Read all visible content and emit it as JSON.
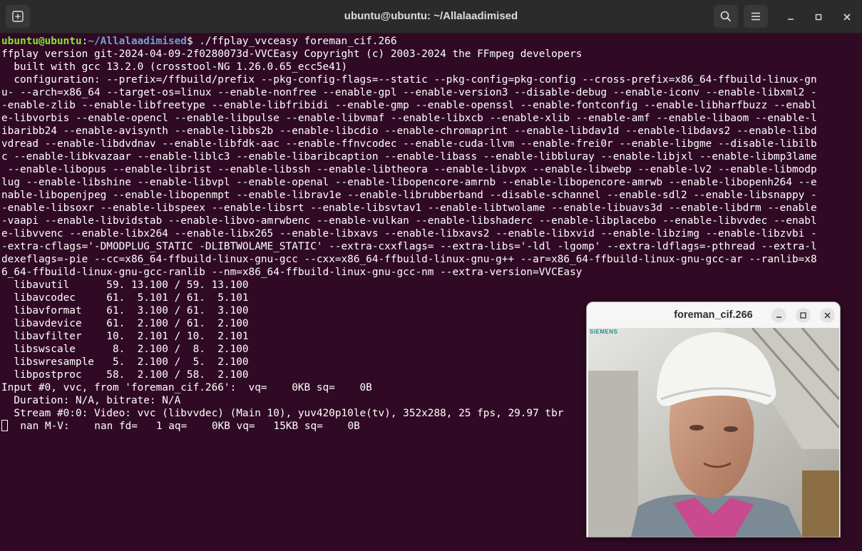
{
  "window": {
    "title": "ubuntu@ubuntu: ~/Allalaadimised",
    "icons": {
      "new_tab": "new-tab-icon",
      "search": "search-icon",
      "menu": "hamburger-menu-icon",
      "minimize": "minimize-icon",
      "maximize": "maximize-icon",
      "close": "close-icon"
    }
  },
  "terminal": {
    "prompt_user": "ubuntu@ubuntu",
    "prompt_sep": ":",
    "prompt_path": "~/Allalaadimised",
    "prompt_symbol": "$ ",
    "command": "./ffplay_vvceasy foreman_cif.266",
    "output_lines": [
      "ffplay version git-2024-04-09-2f0280073d-VVCEasy Copyright (c) 2003-2024 the FFmpeg developers",
      "  built with gcc 13.2.0 (crosstool-NG 1.26.0.65_ecc5e41)",
      "  configuration: --prefix=/ffbuild/prefix --pkg-config-flags=--static --pkg-config=pkg-config --cross-prefix=x86_64-ffbuild-linux-gn",
      "u- --arch=x86_64 --target-os=linux --enable-nonfree --enable-gpl --enable-version3 --disable-debug --enable-iconv --enable-libxml2 -",
      "-enable-zlib --enable-libfreetype --enable-libfribidi --enable-gmp --enable-openssl --enable-fontconfig --enable-libharfbuzz --enabl",
      "e-libvorbis --enable-opencl --enable-libpulse --enable-libvmaf --enable-libxcb --enable-xlib --enable-amf --enable-libaom --enable-l",
      "ibaribb24 --enable-avisynth --enable-libbs2b --enable-libcdio --enable-chromaprint --enable-libdav1d --enable-libdavs2 --enable-libd",
      "vdread --enable-libdvdnav --enable-libfdk-aac --enable-ffnvcodec --enable-cuda-llvm --enable-frei0r --enable-libgme --disable-libilb",
      "c --enable-libkvazaar --enable-liblc3 --enable-libaribcaption --enable-libass --enable-libbluray --enable-libjxl --enable-libmp3lame",
      " --enable-libopus --enable-librist --enable-libssh --enable-libtheora --enable-libvpx --enable-libwebp --enable-lv2 --enable-libmodp",
      "lug --enable-libshine --enable-libvpl --enable-openal --enable-libopencore-amrnb --enable-libopencore-amrwb --enable-libopenh264 --e",
      "nable-libopenjpeg --enable-libopenmpt --enable-librav1e --enable-librubberband --disable-schannel --enable-sdl2 --enable-libsnappy -",
      "-enable-libsoxr --enable-libspeex --enable-libsrt --enable-libsvtav1 --enable-libtwolame --enable-libuavs3d --enable-libdrm --enable",
      "-vaapi --enable-libvidstab --enable-libvo-amrwbenc --enable-vulkan --enable-libshaderc --enable-libplacebo --enable-libvvdec --enabl",
      "e-libvvenc --enable-libx264 --enable-libx265 --enable-libxavs --enable-libxavs2 --enable-libxvid --enable-libzimg --enable-libzvbi -",
      "-extra-cflags='-DMODPLUG_STATIC -DLIBTWOLAME_STATIC' --extra-cxxflags= --extra-libs='-ldl -lgomp' --extra-ldflags=-pthread --extra-l",
      "dexeflags=-pie --cc=x86_64-ffbuild-linux-gnu-gcc --cxx=x86_64-ffbuild-linux-gnu-g++ --ar=x86_64-ffbuild-linux-gnu-gcc-ar --ranlib=x8",
      "6_64-ffbuild-linux-gnu-gcc-ranlib --nm=x86_64-ffbuild-linux-gnu-gcc-nm --extra-version=VVCEasy",
      "  libavutil      59. 13.100 / 59. 13.100",
      "  libavcodec     61.  5.101 / 61.  5.101",
      "  libavformat    61.  3.100 / 61.  3.100",
      "  libavdevice    61.  2.100 / 61.  2.100",
      "  libavfilter    10.  2.101 / 10.  2.101",
      "  libswscale      8.  2.100 /  8.  2.100",
      "  libswresample   5.  2.100 /  5.  2.100",
      "  libpostproc    58.  2.100 / 58.  2.100",
      "Input #0, vvc, from 'foreman_cif.266':  vq=    0KB sq=    0B",
      "  Duration: N/A, bitrate: N/A",
      "  Stream #0:0: Video: vvc (libvvdec) (Main 10), yuv420p10le(tv), 352x288, 25 fps, 29.97 tbr"
    ],
    "status_line": "  nan M-V:    nan fd=   1 aq=    0KB vq=   15KB sq=    0B"
  },
  "video_window": {
    "title": "foreman_cif.266",
    "watermark": "SIEMENS",
    "icons": {
      "minimize": "minimize-icon",
      "maximize": "maximize-icon",
      "close": "close-icon"
    }
  }
}
